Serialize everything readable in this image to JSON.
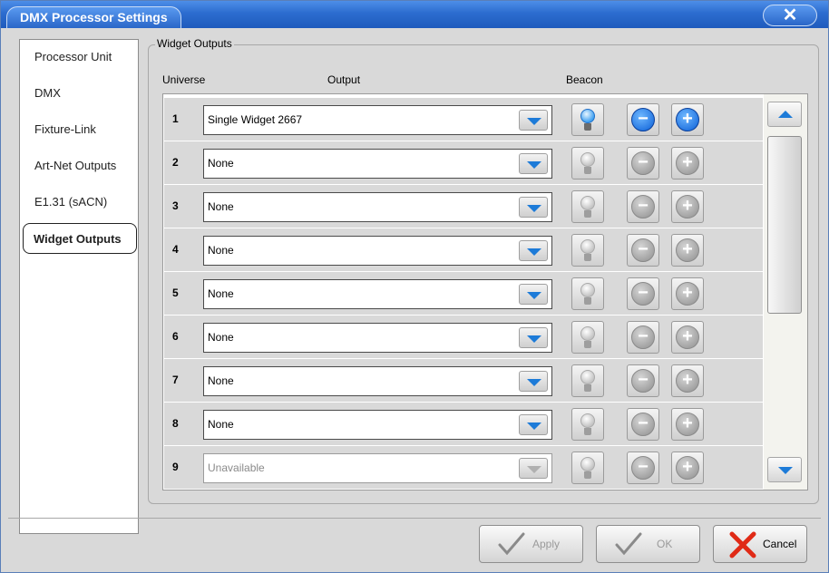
{
  "window": {
    "title": "DMX Processor Settings",
    "close_symbol": "✕"
  },
  "sidebar": {
    "items": [
      {
        "label": "Processor Unit"
      },
      {
        "label": "DMX"
      },
      {
        "label": "Fixture-Link"
      },
      {
        "label": "Art-Net Outputs"
      },
      {
        "label": "E1.31 (sACN)"
      },
      {
        "label": "Widget Outputs"
      }
    ],
    "selected": "Widget Outputs"
  },
  "panel": {
    "group_title": "Widget Outputs",
    "headers": {
      "universe": "Universe",
      "output": "Output",
      "beacon": "Beacon"
    },
    "rows": [
      {
        "universe": "1",
        "output": "Single Widget 2667",
        "enabled": true,
        "beacon_on": true
      },
      {
        "universe": "2",
        "output": "None",
        "enabled": true,
        "beacon_on": false
      },
      {
        "universe": "3",
        "output": "None",
        "enabled": true,
        "beacon_on": false
      },
      {
        "universe": "4",
        "output": "None",
        "enabled": true,
        "beacon_on": false
      },
      {
        "universe": "5",
        "output": "None",
        "enabled": true,
        "beacon_on": false
      },
      {
        "universe": "6",
        "output": "None",
        "enabled": true,
        "beacon_on": false
      },
      {
        "universe": "7",
        "output": "None",
        "enabled": true,
        "beacon_on": false
      },
      {
        "universe": "8",
        "output": "None",
        "enabled": true,
        "beacon_on": false
      },
      {
        "universe": "9",
        "output": "Unavailable",
        "enabled": false,
        "beacon_on": false
      }
    ]
  },
  "buttons": {
    "apply": {
      "label": "Apply",
      "enabled": false
    },
    "ok": {
      "label": "OK",
      "enabled": false
    },
    "cancel": {
      "label": "Cancel",
      "enabled": true
    }
  },
  "colors": {
    "title_blue": "#2c6ccf",
    "accent_blue": "#1d7bd8",
    "cancel_red": "#e02a16"
  }
}
